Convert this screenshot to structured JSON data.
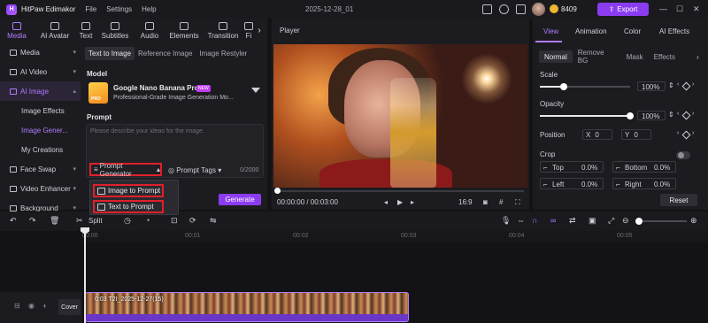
{
  "app": {
    "name": "HitPaw Edimakor",
    "logo_letter": "H",
    "menu": [
      "File",
      "Settings",
      "Help"
    ],
    "title": "2025-12-28_01",
    "credits": "8409",
    "export_label": "Export"
  },
  "top_tabs": [
    {
      "label": "Media",
      "active": true
    },
    {
      "label": "AI Avatar"
    },
    {
      "label": "Text"
    },
    {
      "label": "Subtitles"
    },
    {
      "label": "Audio"
    },
    {
      "label": "Elements"
    },
    {
      "label": "Transition"
    },
    {
      "label": "Fi"
    }
  ],
  "sidenav": {
    "items": [
      {
        "label": "Media",
        "icon": "media-icon"
      },
      {
        "label": "AI Video",
        "icon": "ai-video-icon"
      },
      {
        "label": "AI Image",
        "icon": "ai-image-icon",
        "active": true
      },
      {
        "label": "Image Effects",
        "sub": true
      },
      {
        "label": "Image Gener...",
        "sub": true,
        "selected": true
      },
      {
        "label": "My Creations",
        "sub": true
      },
      {
        "label": "Face Swap",
        "icon": "face-swap-icon"
      },
      {
        "label": "Video Enhancer",
        "icon": "video-enhancer-icon"
      },
      {
        "label": "Background",
        "icon": "background-icon"
      }
    ]
  },
  "panel": {
    "subtabs": [
      "Text to Image",
      "Reference Image",
      "Image Restyler"
    ],
    "model_label": "Model",
    "model_name": "Google Nano Banana Pro",
    "model_badge": "NEW",
    "model_thumb_text": "PRO",
    "model_desc": "Professional-Grade Image Generation Mo...",
    "prompt_label": "Prompt",
    "prompt_placeholder": "Please describe your ideas for the image.",
    "prompt_generator": "Prompt Generator",
    "prompt_tags": "Prompt Tags",
    "char_count": "0/2000",
    "dropdown": [
      "Image to Prompt",
      "Text to Prompt"
    ],
    "generate_label": "Generate"
  },
  "player": {
    "title": "Player",
    "time": "00:00:00 / 00:03:00",
    "aspect": "16:9"
  },
  "inspector": {
    "tabs": [
      "View",
      "Animation",
      "Color",
      "AI Effects"
    ],
    "segments": [
      "Normal",
      "Remove BG",
      "Mask",
      "Effects"
    ],
    "scale_label": "Scale",
    "scale_value": "100%",
    "scale": 1.0,
    "opacity_label": "Opacity",
    "opacity_value": "100%",
    "opacity": 1.0,
    "position_label": "Position",
    "pos_x_label": "X",
    "pos_x": "0",
    "pos_y_label": "Y",
    "pos_y": "0",
    "crop_label": "Crop",
    "crop": [
      {
        "label": "Top",
        "value": "0.0%"
      },
      {
        "label": "Bottom",
        "value": "0.0%"
      },
      {
        "label": "Left",
        "value": "0.0%"
      },
      {
        "label": "Right",
        "value": "0.0%"
      }
    ],
    "reset_label": "Reset"
  },
  "timeline": {
    "split_label": "Split",
    "ruler": [
      "00:00",
      "00:01",
      "00:02",
      "00:03",
      "00:04",
      "00:05"
    ],
    "cover_label": "Cover",
    "clip_label": "0:03  T2I_2025-12-27(15)"
  },
  "colors": {
    "accent": "#8b3cf0",
    "accent_text": "#b07cff",
    "highlight": "#e0202a"
  }
}
